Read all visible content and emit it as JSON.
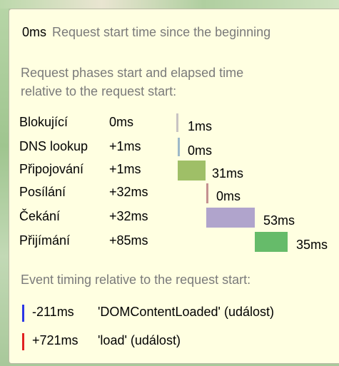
{
  "header": {
    "start_value": "0ms",
    "start_desc": "Request start time since the beginning"
  },
  "phases_heading_line1": "Request phases start and elapsed time",
  "phases_heading_line2": "relative to the request start:",
  "phases": [
    {
      "name": "Blokující",
      "start": "0ms",
      "duration": "1ms",
      "color": "#c8c3c3",
      "fill": 0
    },
    {
      "name": "DNS lookup",
      "start": "+1ms",
      "duration": "0ms",
      "color": "#9db9c8",
      "fill": 0
    },
    {
      "name": "Připojování",
      "start": "+1ms",
      "duration": "31ms",
      "color": "#9fbf67",
      "fill": 1
    },
    {
      "name": "Posílání",
      "start": "+32ms",
      "duration": "0ms",
      "color": "#c49090",
      "fill": 0
    },
    {
      "name": "Čekání",
      "start": "+32ms",
      "duration": "53ms",
      "color": "#b0a4cc",
      "fill": 1
    },
    {
      "name": "Přijímání",
      "start": "+85ms",
      "duration": "35ms",
      "color": "#66bb6a",
      "fill": 1
    }
  ],
  "events_heading": "Event timing relative to the request start:",
  "events": [
    {
      "time": "-211ms",
      "label": "'DOMContentLoaded' (událost)",
      "color": "#2b36e6"
    },
    {
      "time": "+721ms",
      "label": "'load' (událost)",
      "color": "#e02121"
    }
  ]
}
